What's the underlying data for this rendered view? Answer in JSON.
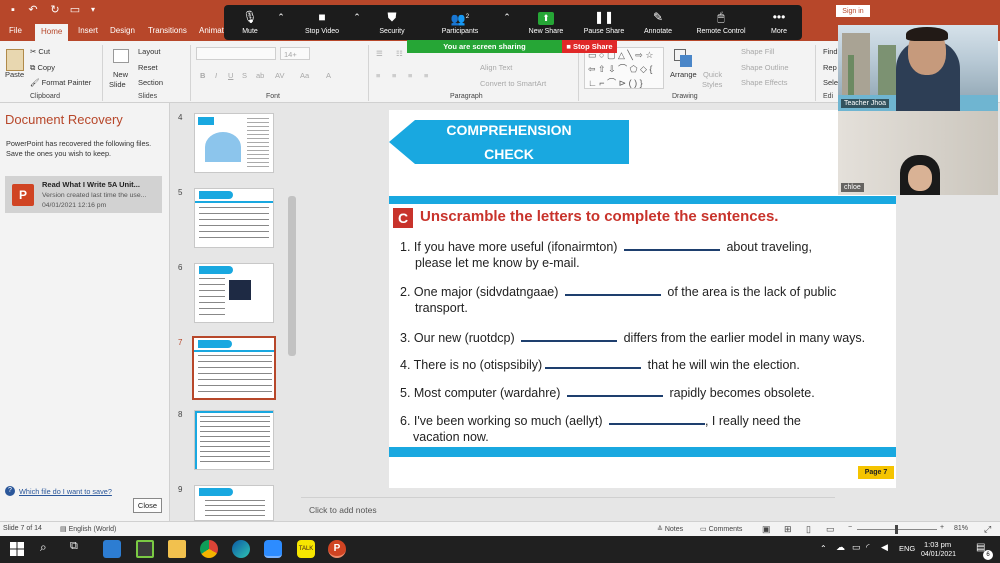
{
  "titlebar": {
    "signin_label": "Sign in"
  },
  "ribbon": {
    "tabs": [
      "File",
      "Home",
      "Insert",
      "Design",
      "Transitions",
      "Animat"
    ],
    "clipboard": {
      "paste": "Paste",
      "cut": "Cut",
      "copy": "Copy",
      "format_painter": "Format Painter",
      "label": "Clipboard"
    },
    "slides": {
      "new_slide": "New",
      "new_slide2": "Slide",
      "layout": "Layout",
      "reset": "Reset",
      "section": "Section",
      "label": "Slides"
    },
    "font": {
      "size": "14+",
      "label": "Font"
    },
    "paragraph": {
      "align_text": "Align Text",
      "smartart": "Convert to SmartArt",
      "label": "Paragraph"
    },
    "drawing": {
      "arrange": "Arrange",
      "quick_styles": "Quick",
      "quick_styles2": "Styles",
      "shape_fill": "Shape Fill",
      "shape_outline": "Shape Outline",
      "shape_effects": "Shape Effects",
      "label": "Drawing"
    },
    "editing": {
      "find": "Find",
      "replace": "Rep",
      "select": "Sele",
      "label": "Edi"
    }
  },
  "zoom": {
    "mute": "Mute",
    "stop_video": "Stop Video",
    "security": "Security",
    "participants": "Participants",
    "participants_count": "2",
    "new_share": "New Share",
    "pause_share": "Pause Share",
    "annotate": "Annotate",
    "remote_control": "Remote Control",
    "more": "More",
    "sharing_status": "You are screen sharing",
    "stop_share": "Stop Share"
  },
  "video": {
    "host_name": "Teacher Jhoa",
    "guest_name": "chloe"
  },
  "recovery": {
    "title": "Document Recovery",
    "description": "PowerPoint has recovered the following files.  Save the ones you wish to keep.",
    "file_name": "Read What I Write 5A Unit...",
    "file_status": "Version created last time the use...",
    "file_date": "04/01/2021 12:16 pm",
    "help_link": "Which file do I want to save?",
    "close_label": "Close"
  },
  "thumbnails": [
    "4",
    "5",
    "6",
    "7",
    "8",
    "9"
  ],
  "slide": {
    "banner_line1": "COMPREHENSION",
    "banner_line2": "CHECK",
    "section_letter": "C",
    "instruction": "Unscramble the letters to complete the sentences.",
    "q1a": "1. If you have more useful (ifonairmton)",
    "q1b": "about traveling,",
    "q1c": "please let me know by e-mail.",
    "q2a": "2. One major (sidvdatngaae)",
    "q2b": "of the area is the lack of public",
    "q2c": "transport.",
    "q3a": "3. Our new (ruotdcp)",
    "q3b": "differs from the earlier model in many ways.",
    "q4a": "4. There is no (otispsibily)",
    "q4b": "that he will win the election.",
    "q5a": "5. Most computer (wardahre)",
    "q5b": "rapidly becomes obsolete.",
    "q6a": "6. I've been working so much (aellyt)",
    "q6b": ", I really need the",
    "q6c": "vacation now.",
    "page_tag": "Page 7"
  },
  "notes_placeholder": "Click to add notes",
  "statusbar": {
    "slide_info": "Slide 7 of 14",
    "language": "English (World)",
    "notes": "Notes",
    "comments": "Comments",
    "zoom_level": "81%"
  },
  "taskbar": {
    "language": "ENG",
    "time": "1:03 pm",
    "date": "04/01/2021",
    "notification_count": "6"
  },
  "colors": {
    "ppt_accent": "#b7472a",
    "slide_blue": "#19a8e0",
    "slide_red": "#c8332b",
    "zoom_green": "#26a636",
    "zoom_red": "#e02828"
  }
}
